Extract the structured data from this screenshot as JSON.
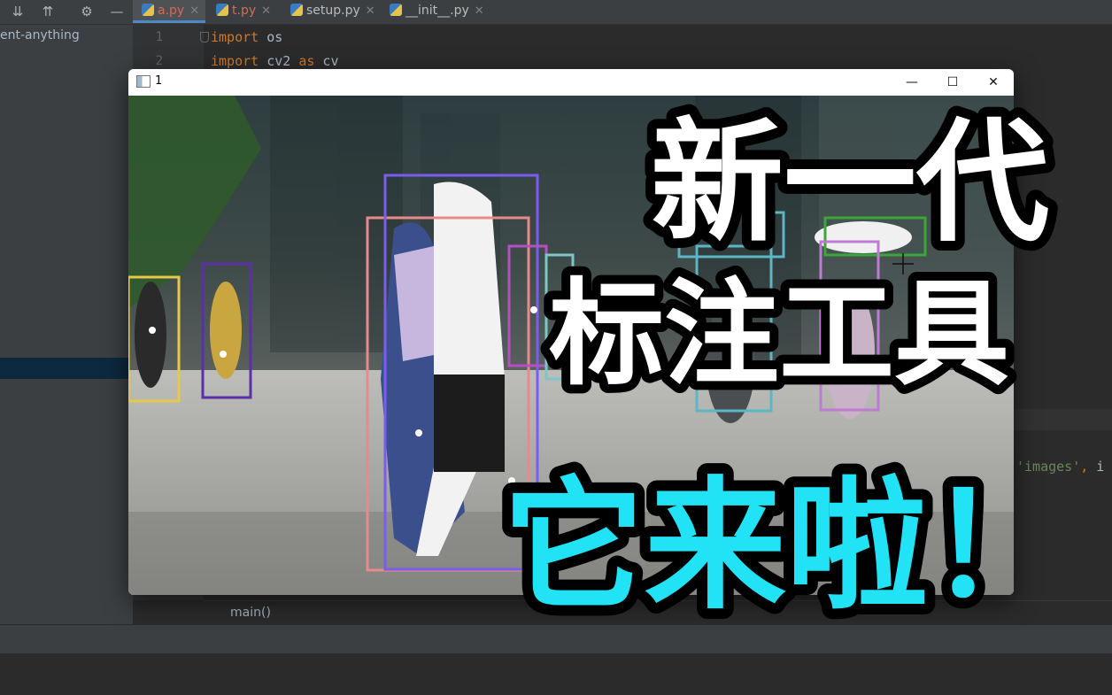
{
  "ide": {
    "tabs": [
      {
        "label": "a.py",
        "active": true,
        "modified": true
      },
      {
        "label": "t.py",
        "active": false,
        "modified": true
      },
      {
        "label": "setup.py",
        "active": false,
        "modified": false
      },
      {
        "label": "__init__.py",
        "active": false,
        "modified": false
      }
    ],
    "project_name": "ent-anything",
    "line_numbers": [
      "1",
      "2"
    ],
    "code_lines": [
      {
        "kw": "import",
        "rest": " os"
      },
      {
        "kw": "import",
        "rest": " cv2 ",
        "kw2": "as",
        "rest2": " cv"
      }
    ],
    "code_right": {
      "string": "'images'",
      "comma": ",",
      "plain": " i"
    },
    "breadcrumb": "main()"
  },
  "window": {
    "title": "1",
    "buttons": {
      "minimize": "—",
      "maximize": "☐",
      "close": "✕"
    }
  },
  "overlay": {
    "line1": "新一代",
    "line2": "标注工具",
    "line3": "它来啦！"
  },
  "colors": {
    "accent_cyan": "#22e3f5",
    "ide_bg": "#2b2b2b",
    "panel_bg": "#3c3f41",
    "box_colors": [
      "#e6c84a",
      "#5a2fa8",
      "#e88a8a",
      "#7b5cf0",
      "#b44fc4",
      "#7fc6cc",
      "#5bb6c6",
      "#3aa63a",
      "#c07ad6"
    ]
  }
}
